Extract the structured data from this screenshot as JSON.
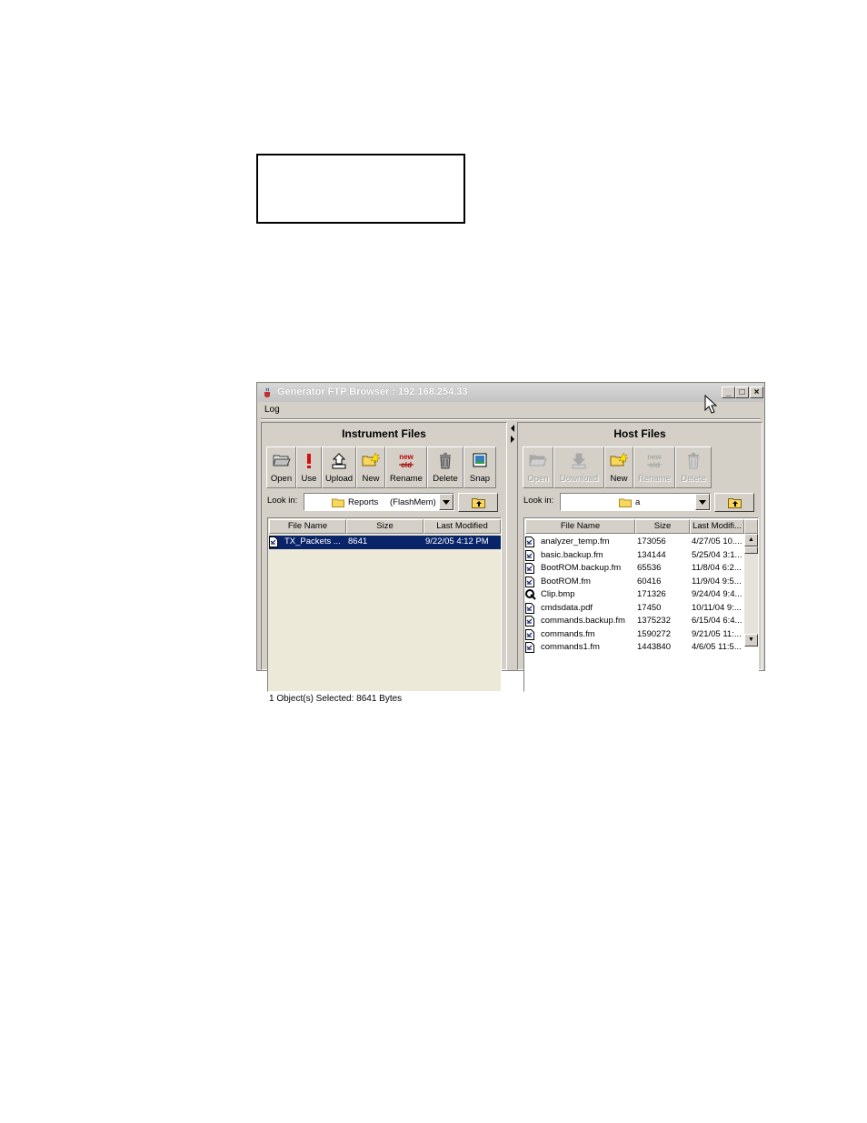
{
  "window": {
    "title": "Generator FTP Browser : 192.168.254.33",
    "controls": {
      "minimize": "_",
      "maximize": "□",
      "close": "×"
    }
  },
  "menu": {
    "log": "Log"
  },
  "instrument": {
    "title": "Instrument Files",
    "toolbar": [
      {
        "label": "Open",
        "icon": "folder-open-icon"
      },
      {
        "label": "Use",
        "icon": "exclamation-icon"
      },
      {
        "label": "Upload",
        "icon": "upload-icon"
      },
      {
        "label": "New",
        "icon": "new-folder-icon"
      },
      {
        "label": "Rename",
        "icon": "new-old-rename-icon",
        "text_new": "new",
        "text_old": "old"
      },
      {
        "label": "Delete",
        "icon": "trash-icon"
      },
      {
        "label": "Snap",
        "icon": "snapshot-icon"
      }
    ],
    "look_in_label": "Look in:",
    "look_in_value": "Reports",
    "look_in_sub": "(FlashMem)",
    "columns": [
      "File Name",
      "Size",
      "Last Modified"
    ],
    "rows": [
      {
        "name": "TX_Packets ...",
        "size": "8641",
        "modified": "9/22/05 4:12 PM"
      }
    ],
    "status": "1 Object(s) Selected:  8641 Bytes"
  },
  "host": {
    "title": "Host Files",
    "toolbar": [
      {
        "label": "Open",
        "icon": "folder-open-icon",
        "disabled": true
      },
      {
        "label": "Download",
        "icon": "download-icon",
        "disabled": true
      },
      {
        "label": "New",
        "icon": "new-folder-icon",
        "disabled": false
      },
      {
        "label": "Rename",
        "icon": "new-old-rename-icon",
        "disabled": true,
        "text_new": "new",
        "text_old": "old"
      },
      {
        "label": "Delete",
        "icon": "trash-icon",
        "disabled": true
      }
    ],
    "look_in_label": "Look in:",
    "look_in_value": "a",
    "columns": [
      "File Name",
      "Size",
      "Last Modifi..."
    ],
    "rows": [
      {
        "name": "analyzer_temp.fm",
        "size": "173056",
        "modified": "4/27/05 10...."
      },
      {
        "name": "basic.backup.fm",
        "size": "134144",
        "modified": "5/25/04 3:1..."
      },
      {
        "name": "BootROM.backup.fm",
        "size": "65536",
        "modified": "11/8/04 6:2..."
      },
      {
        "name": "BootROM.fm",
        "size": "60416",
        "modified": "11/9/04 9:5..."
      },
      {
        "name": "Clip.bmp",
        "size": "171326",
        "modified": "9/24/04 9:4...",
        "icon": "clip-icon"
      },
      {
        "name": "cmdsdata.pdf",
        "size": "17450",
        "modified": "10/11/04 9:..."
      },
      {
        "name": "commands.backup.fm",
        "size": "1375232",
        "modified": "6/15/04 6:4..."
      },
      {
        "name": "commands.fm",
        "size": "1590272",
        "modified": "9/21/05 11:..."
      },
      {
        "name": "commands1.fm",
        "size": "1443840",
        "modified": "4/6/05 11:5..."
      }
    ]
  }
}
